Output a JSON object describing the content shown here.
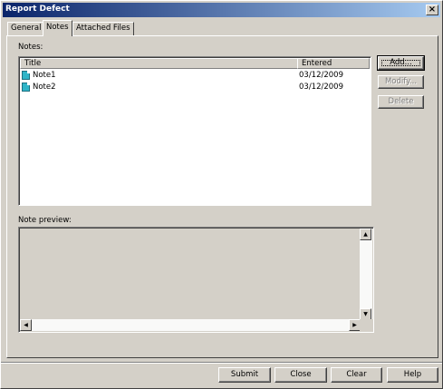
{
  "window": {
    "title": "Report Defect",
    "close_glyph": "×"
  },
  "tabs": [
    {
      "label": "General",
      "active": false
    },
    {
      "label": "Notes",
      "active": true
    },
    {
      "label": "Attached Files",
      "active": false
    }
  ],
  "notes_panel": {
    "notes_label": "Notes:",
    "columns": [
      "Title",
      "Entered"
    ],
    "rows": [
      {
        "icon": "note-icon",
        "title": "Note1",
        "entered": "03/12/2009"
      },
      {
        "icon": "note-icon",
        "title": "Note2",
        "entered": "03/12/2009"
      }
    ],
    "side_buttons": {
      "add": "Add...",
      "modify": "Modify...",
      "delete": "Delete"
    },
    "preview_label": "Note preview:",
    "scroll_glyphs": {
      "up": "▲",
      "down": "▼",
      "left": "◀",
      "right": "▶"
    }
  },
  "footer_buttons": {
    "submit": "Submit",
    "close": "Close",
    "clear": "Clear",
    "help": "Help"
  },
  "colors": {
    "face": "#d4d0c8",
    "title_start": "#0a246a",
    "title_end": "#a6caf0",
    "note_icon": "#2fb5c8"
  }
}
